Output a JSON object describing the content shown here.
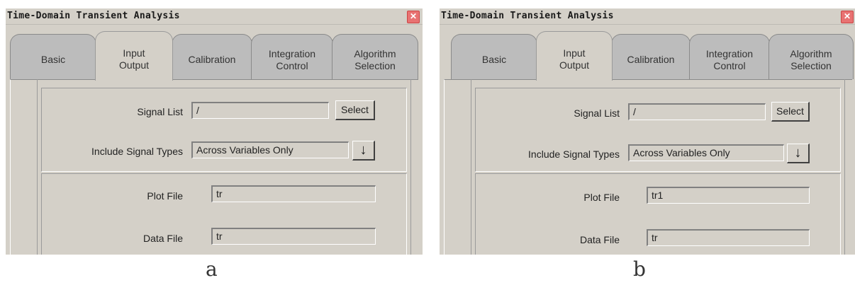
{
  "panels": [
    {
      "window": {
        "title": "Time-Domain Transient Analysis",
        "close_glyph": "✕"
      },
      "tabs": [
        {
          "label": "Basic",
          "active": false
        },
        {
          "label": "Input\nOutput",
          "active": true
        },
        {
          "label": "Calibration",
          "active": false
        },
        {
          "label": "Integration\nControl",
          "active": false
        },
        {
          "label": "Algorithm\nSelection",
          "active": false
        }
      ],
      "signal_list": {
        "label": "Signal List",
        "value": "/",
        "button": "Select"
      },
      "include_signal_types": {
        "label": "Include Signal Types",
        "value": "Across Variables Only",
        "arrow": "↓"
      },
      "plot_file": {
        "label": "Plot File",
        "value": "tr"
      },
      "data_file": {
        "label": "Data File",
        "value": "tr"
      },
      "caption": "a"
    },
    {
      "window": {
        "title": "Time-Domain Transient Analysis",
        "close_glyph": "✕"
      },
      "tabs": [
        {
          "label": "Basic",
          "active": false
        },
        {
          "label": "Input\nOutput",
          "active": true
        },
        {
          "label": "Calibration",
          "active": false
        },
        {
          "label": "Integration\nControl",
          "active": false
        },
        {
          "label": "Algorithm\nSelection",
          "active": false
        }
      ],
      "signal_list": {
        "label": "Signal List",
        "value": "/",
        "button": "Select"
      },
      "include_signal_types": {
        "label": "Include Signal Types",
        "value": "Across Variables Only",
        "arrow": "↓"
      },
      "plot_file": {
        "label": "Plot File",
        "value": "tr1"
      },
      "data_file": {
        "label": "Data File",
        "value": "tr"
      },
      "caption": "b"
    }
  ]
}
